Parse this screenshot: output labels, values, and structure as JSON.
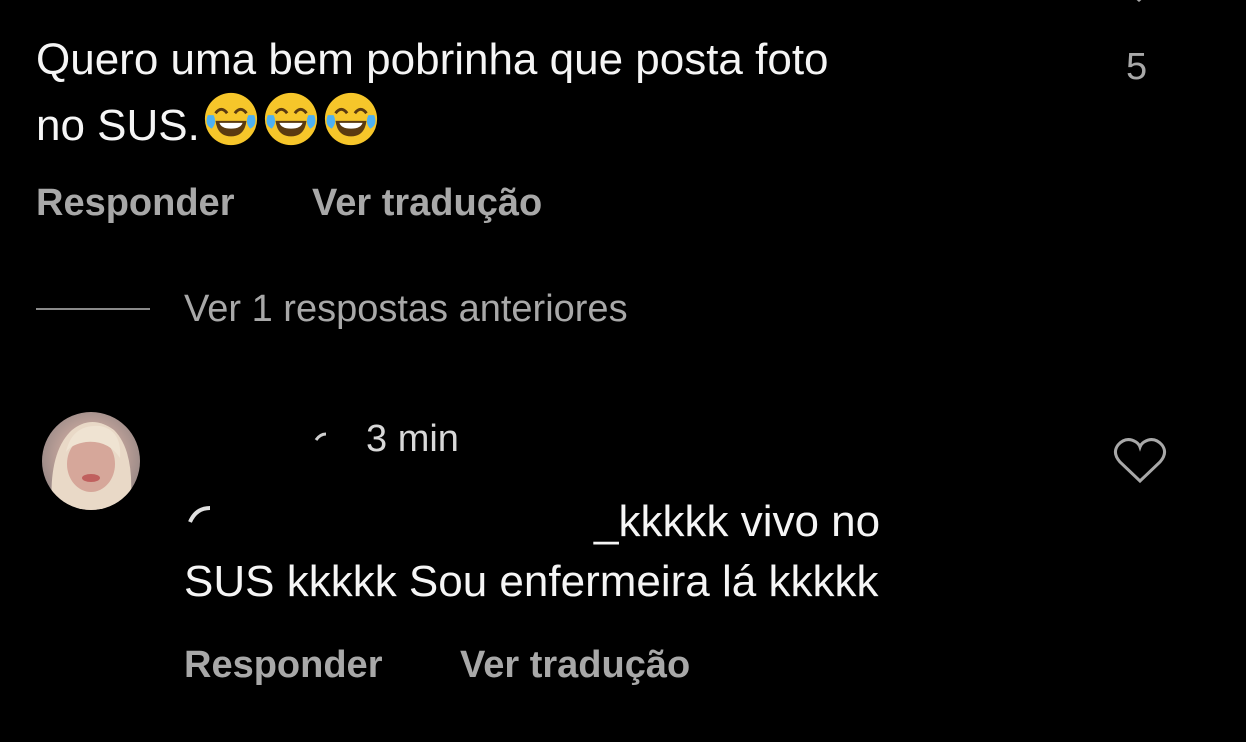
{
  "comment": {
    "text_line1": "Quero uma bem pobrinha que posta foto",
    "text_line2": "no SUS.",
    "emojis": [
      "face-with-tears-of-joy",
      "face-with-tears-of-joy",
      "face-with-tears-of-joy"
    ],
    "like_count": "5",
    "reply_label": "Responder",
    "translate_label": "Ver tradução"
  },
  "replies_toggle": {
    "label": "Ver 1 respostas anteriores"
  },
  "reply": {
    "timestamp": "3 min",
    "text_line1_visible": "_kkkkk vivo no",
    "text_line2": "SUS kkkkk Sou enfermeira lá kkkkk",
    "reply_label": "Responder",
    "translate_label": "Ver tradução"
  },
  "colors": {
    "background": "#000000",
    "primary_text": "#f5f5f5",
    "secondary_text": "#a8a8a8"
  }
}
